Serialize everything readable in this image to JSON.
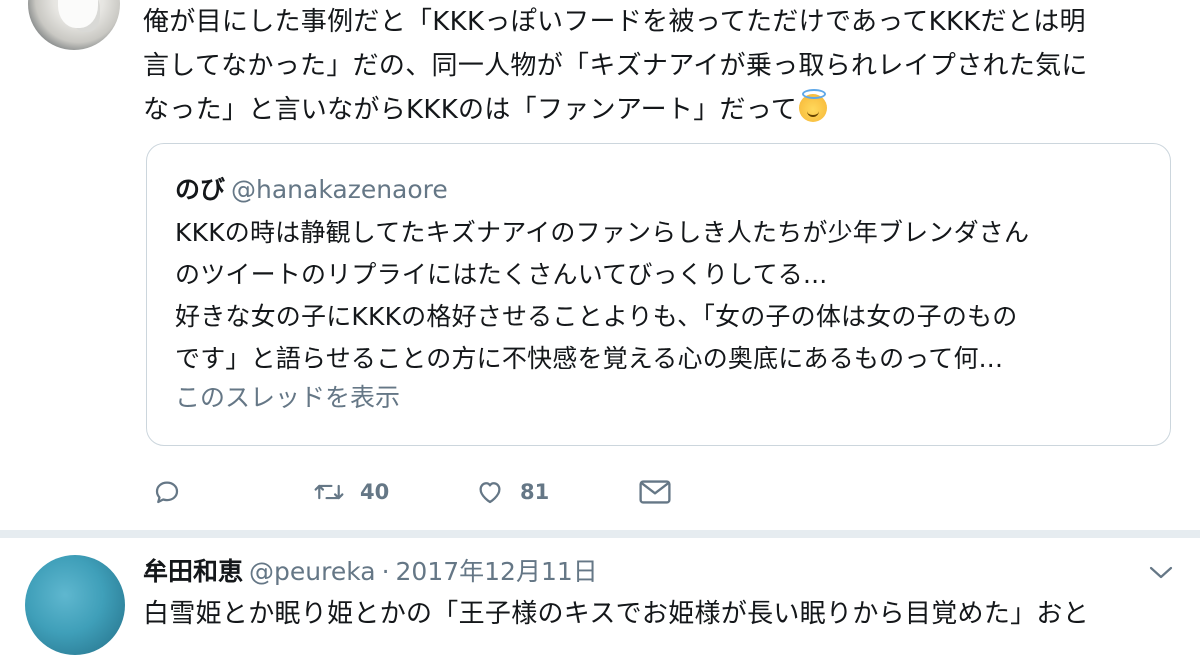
{
  "tweet1": {
    "body_lines": [
      "俺が目にした事例だと「KKKっぽいフードを被ってただけであってKKKだとは明",
      "言してなかった」だの、同一人物が「キズナアイが乗っ取られレイプされた気に",
      "なった」と言いながらKKKのは「ファンアート」だって"
    ],
    "emoji": "smiling-face-with-halo",
    "quote": {
      "name": "のび",
      "handle": "@hanakazenaore",
      "body_lines": [
        "KKKの時は静観してたキズナアイのファンらしき人たちが少年ブレンダさん",
        "のツイートのリプライにはたくさんいてびっくりしてる...",
        "好きな女の子にKKKの格好させることよりも、「女の子の体は女の子のもの",
        "です」と語らせることの方に不快感を覚える心の奥底にあるものって何..."
      ],
      "show_thread": "このスレッドを表示"
    },
    "actions": {
      "reply_icon": "reply-icon",
      "retweet_icon": "retweet-icon",
      "retweet_count": "40",
      "like_icon": "heart-icon",
      "like_count": "81",
      "dm_icon": "envelope-icon"
    }
  },
  "tweet2": {
    "name": "牟田和恵",
    "handle": "@peureka",
    "separator": "·",
    "date": "2017年12月11日",
    "body": "白雪姫とか眠り姫とかの「王子様のキスでお姫様が長い眠りから目覚めた」おと",
    "menu_icon": "chevron-down-icon"
  },
  "colors": {
    "text": "#14171a",
    "secondary": "#657786",
    "border": "#ccd6dd",
    "divider": "#e6ecf0"
  }
}
